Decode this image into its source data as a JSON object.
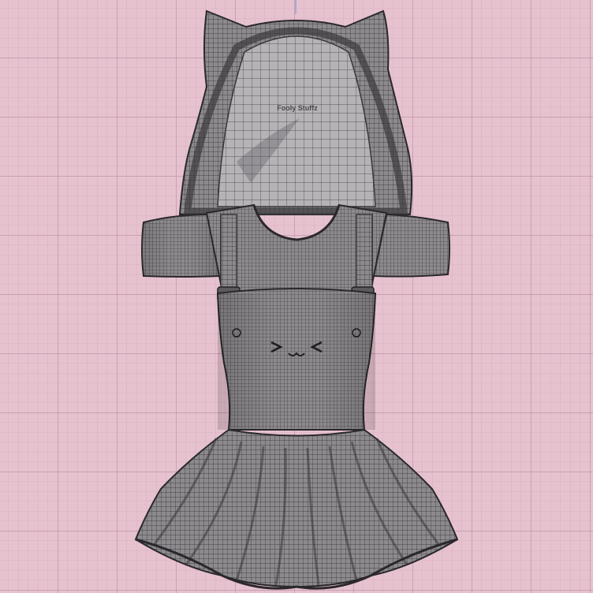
{
  "viewport": {
    "background_color": "#e6c2cf",
    "grid_minor_color": "#d7aabd",
    "grid_major_color": "#b98ba0",
    "axis_color": "#6f8fd8"
  },
  "model": {
    "fill_color": "#8d8a8e",
    "wire_color": "#2f2d31",
    "inner_color": "#b6b3b7",
    "text_label": "Fooly Stuffz"
  }
}
